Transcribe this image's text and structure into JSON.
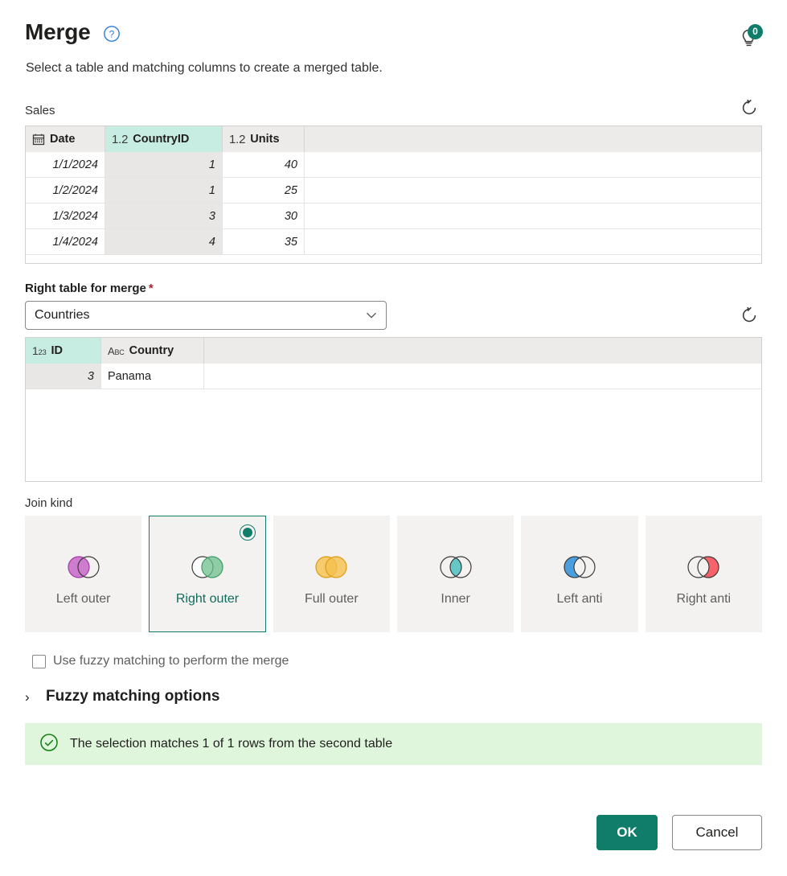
{
  "dialog": {
    "title": "Merge",
    "subtitle": "Select a table and matching columns to create a merged table.",
    "help_icon": "help-circle-icon",
    "tips_icon": "lightbulb-icon",
    "tips_badge": "0"
  },
  "left_table": {
    "label": "Sales",
    "refresh_icon": "refresh-icon",
    "columns": [
      {
        "name": "Date",
        "type_icon": "calendar-icon",
        "selected": false,
        "align": "right",
        "italic": true
      },
      {
        "name": "CountryID",
        "type_icon": "decimal-number-icon",
        "type_glyph": "1.2",
        "selected": true,
        "align": "right",
        "italic": true
      },
      {
        "name": "Units",
        "type_icon": "decimal-number-icon",
        "type_glyph": "1.2",
        "selected": false,
        "align": "right",
        "italic": true
      }
    ],
    "rows": [
      [
        "1/1/2024",
        "1",
        "40"
      ],
      [
        "1/2/2024",
        "1",
        "25"
      ],
      [
        "1/3/2024",
        "3",
        "30"
      ],
      [
        "1/4/2024",
        "4",
        "35"
      ]
    ]
  },
  "right_table": {
    "label": "Right table for merge",
    "required_marker": "*",
    "selected_value": "Countries",
    "placeholder": "Countries",
    "dropdown_icon": "chevron-down-icon",
    "refresh_icon": "refresh-icon",
    "columns": [
      {
        "name": "ID",
        "type_icon": "whole-number-icon",
        "selected": true,
        "align": "right",
        "italic": true
      },
      {
        "name": "Country",
        "type_icon": "text-abc-icon",
        "selected": false,
        "align": "left",
        "italic": false
      }
    ],
    "rows": [
      [
        "3",
        "Panama"
      ]
    ]
  },
  "join_kind": {
    "label": "Join kind",
    "selected": "Right outer",
    "options": [
      {
        "label": "Left outer",
        "fill": "#c156c1",
        "side": "left",
        "selected": false
      },
      {
        "label": "Right outer",
        "fill": "#6cc08b",
        "side": "right",
        "selected": true
      },
      {
        "label": "Full outer",
        "fill": "#f5c04e",
        "side": "both",
        "selected": false
      },
      {
        "label": "Inner",
        "fill": "#4bc0c0",
        "side": "inner",
        "selected": false
      },
      {
        "label": "Left anti",
        "fill": "#4a9fe0",
        "side": "left-only",
        "selected": false
      },
      {
        "label": "Right anti",
        "fill": "#f8636b",
        "side": "right-only",
        "selected": false
      }
    ]
  },
  "fuzzy": {
    "checkbox_label": "Use fuzzy matching to perform the merge",
    "checked": false,
    "accordion_label": "Fuzzy matching options",
    "accordion_icon": "chevron-right-icon",
    "expanded": false
  },
  "status": {
    "icon": "check-circle-icon",
    "message": "The selection matches 1 of 1 rows from the second table",
    "background": "#dff6dd",
    "icon_color": "#107c10"
  },
  "footer": {
    "ok_label": "OK",
    "cancel_label": "Cancel",
    "primary_color": "#107c6a"
  }
}
